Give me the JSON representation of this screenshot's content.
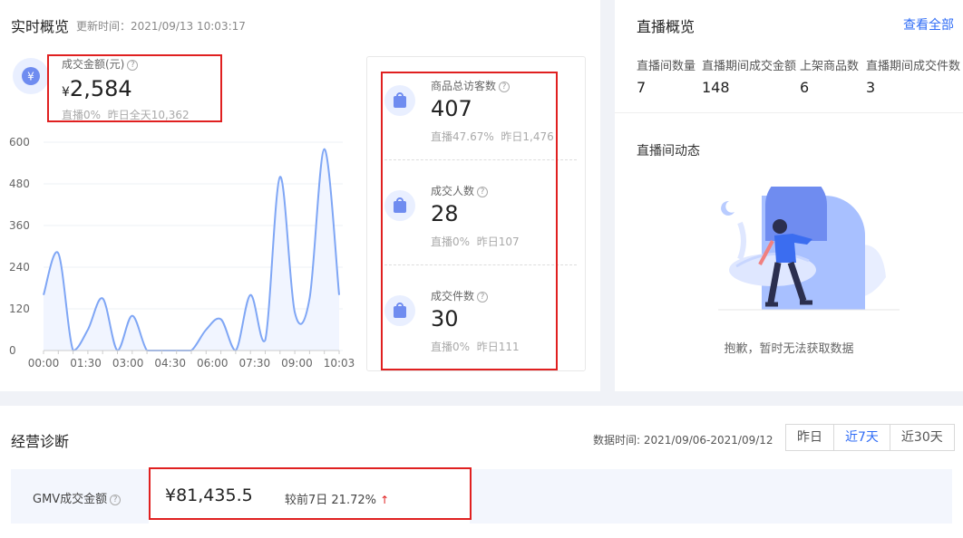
{
  "realtime": {
    "title": "实时概览",
    "update_label": "更新时间：",
    "update_time": "2021/09/13 10:03:17"
  },
  "gmv_card": {
    "label": "成交金额(元)",
    "currency": "¥",
    "value": "2,584",
    "foot_live": "直播0%",
    "foot_yesterday": "昨日全天10,362"
  },
  "chart_data": {
    "type": "line",
    "x": [
      "00:00",
      "00:30",
      "01:00",
      "01:30",
      "02:00",
      "02:30",
      "03:00",
      "03:30",
      "04:00",
      "04:30",
      "05:00",
      "05:30",
      "06:00",
      "06:30",
      "07:00",
      "07:30",
      "08:00",
      "08:30",
      "09:00",
      "09:30",
      "10:00"
    ],
    "series": [
      {
        "values": [
          160,
          280,
          0,
          60,
          150,
          0,
          100,
          0,
          0,
          0,
          0,
          60,
          90,
          0,
          160,
          30,
          500,
          110,
          150,
          580,
          160
        ]
      }
    ],
    "xticks": [
      "00:00",
      "01:30",
      "03:00",
      "04:30",
      "06:00",
      "07:30",
      "09:00",
      "10:03"
    ],
    "yticks": [
      "0",
      "120",
      "240",
      "360",
      "480",
      "600"
    ],
    "ylim": [
      0,
      600
    ],
    "color": "#7fa6f5",
    "grid": true
  },
  "metrics": [
    {
      "label": "商品总访客数",
      "value": "407",
      "foot_live": "直播47.67%",
      "foot_yesterday": "昨日1,476",
      "icon": "visitor-bag-icon"
    },
    {
      "label": "成交人数",
      "value": "28",
      "foot_live": "直播0%",
      "foot_yesterday": "昨日107",
      "icon": "buyer-person-icon"
    },
    {
      "label": "成交件数",
      "value": "30",
      "foot_live": "直播0%",
      "foot_yesterday": "昨日111",
      "icon": "order-bag-icon"
    }
  ],
  "live": {
    "title": "直播概览",
    "view_all": "查看全部",
    "stats": [
      {
        "label": "直播间数量",
        "value": "7"
      },
      {
        "label": "直播期间成交金额",
        "value": "148"
      },
      {
        "label": "上架商品数",
        "value": "6"
      },
      {
        "label": "直播期间成交件数",
        "value": "3"
      }
    ],
    "dynamics_title": "直播间动态",
    "empty_text": "抱歉，暂时无法获取数据"
  },
  "diagnosis": {
    "title": "经营诊断",
    "date_label": "数据时间:",
    "date_range": "2021/09/06-2021/09/12",
    "ranges": [
      "昨日",
      "近7天",
      "近30天"
    ],
    "active_range": "近7天",
    "gmv_label": "GMV成交金额",
    "gmv_value": "¥81,435.5",
    "compare_text": "较前7日 21.72%",
    "trend": "up"
  },
  "colors": {
    "accent": "#2f6cf6",
    "highlight": "#e02020",
    "up": "#e02020"
  }
}
